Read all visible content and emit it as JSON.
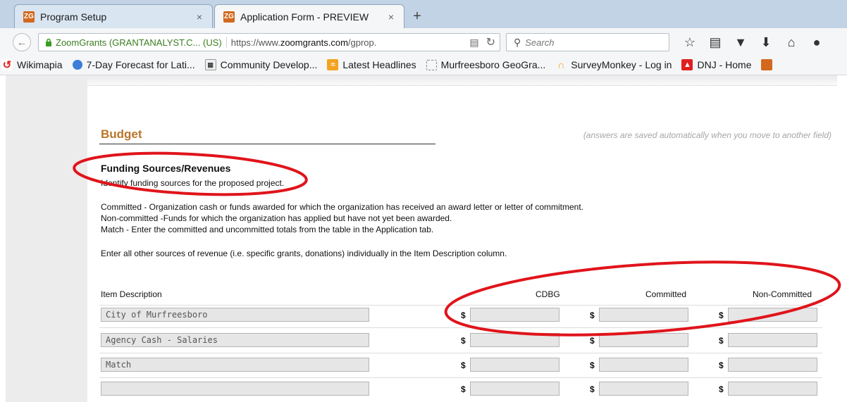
{
  "browser": {
    "tabs": [
      {
        "favicon": "ZG",
        "title": "Program Setup",
        "close": "×"
      },
      {
        "favicon": "ZG",
        "title": "Application Form - PREVIEW",
        "close": "×"
      }
    ],
    "new_tab": "+",
    "identity": "ZoomGrants (GRANTANALYST.C... (US)",
    "url_prefix": "https://www.",
    "url_domain": "zoomgrants.com",
    "url_suffix": "/gprop.",
    "search_placeholder": "Search",
    "bookmarks": [
      {
        "label": "Wikimapia",
        "icon": "wikimapia-icon"
      },
      {
        "label": "7-Day Forecast for Lati...",
        "icon": "weather-icon"
      },
      {
        "label": "Community Develop...",
        "icon": "building-icon"
      },
      {
        "label": "Latest Headlines",
        "icon": "rss-icon"
      },
      {
        "label": "Murfreesboro GeoGra...",
        "icon": "page-icon"
      },
      {
        "label": "SurveyMonkey - Log in",
        "icon": "surveymonkey-icon"
      },
      {
        "label": "DNJ - Home",
        "icon": "dnj-icon"
      }
    ]
  },
  "budget": {
    "title": "Budget",
    "autosave_note": "(answers are saved automatically when you move to another field)",
    "section_title": "Funding Sources/Revenues",
    "intro": "Identify funding sources for the proposed project.",
    "def_committed": "Committed - Organization cash or funds awarded for which the organization has received an award letter or letter of commitment.",
    "def_noncommitted": "Non-committed -Funds for which the organization has applied but have not yet been awarded.",
    "def_match": "Match - Enter the committed and uncommitted totals from the table in the Application tab.",
    "other_sources": "Enter all other sources of revenue (i.e. specific grants, donations) individually in the Item Description column.",
    "columns": {
      "item": "Item Description",
      "cdbg": "CDBG",
      "committed": "Committed",
      "noncommitted": "Non-Committed"
    },
    "currency": "$",
    "rows": [
      {
        "item": "City of Murfreesboro"
      },
      {
        "item": "Agency Cash - Salaries"
      },
      {
        "item": "Match"
      },
      {
        "item": ""
      }
    ]
  },
  "colors": {
    "accent": "#b9752b",
    "annotation": "#e0141b",
    "favicon": "#d2691e"
  }
}
